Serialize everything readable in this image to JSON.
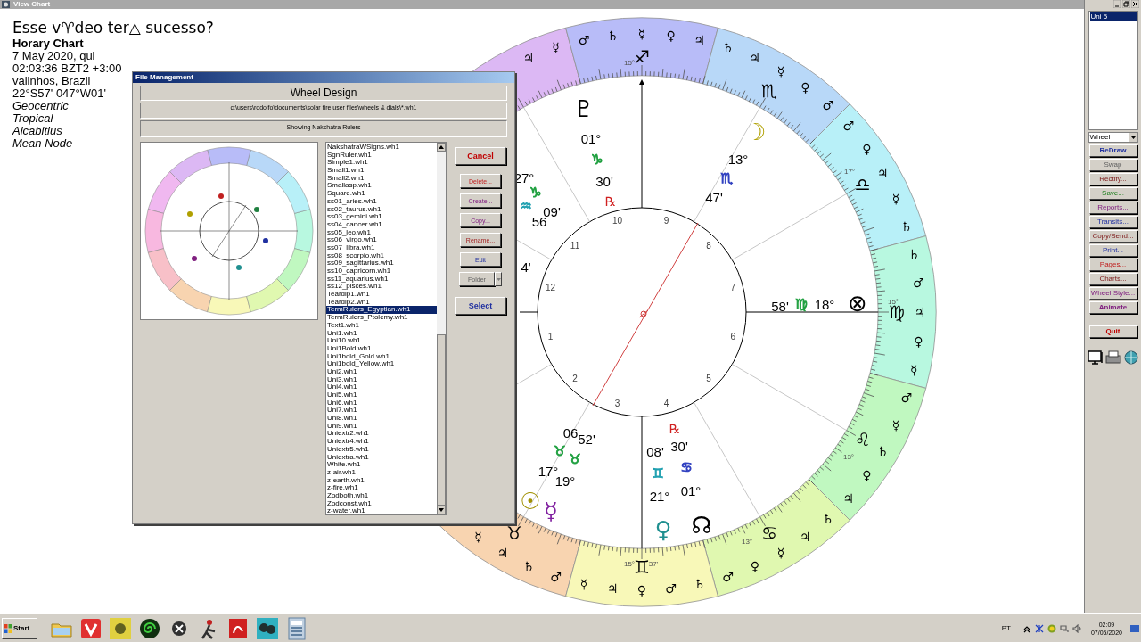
{
  "window": {
    "title": "View Chart"
  },
  "chart_info": {
    "question": "Esse v♈deo ter△ sucesso?",
    "lines": [
      {
        "text": "Horary Chart",
        "kind": "heading"
      },
      {
        "text": "7 May 2020, qui",
        "kind": "detail"
      },
      {
        "text": "02:03:36  BZT2 +3:00",
        "kind": "detail"
      },
      {
        "text": "valinhos, Brazil",
        "kind": "detail"
      },
      {
        "text": "22°S57' 047°W01'",
        "kind": "detail"
      },
      {
        "text": "Geocentric",
        "kind": "setting"
      },
      {
        "text": "Tropical",
        "kind": "setting"
      },
      {
        "text": "Alcabitius",
        "kind": "setting"
      },
      {
        "text": "Mean Node",
        "kind": "setting"
      }
    ]
  },
  "wheel": {
    "signs": [
      {
        "kind": "capricorn",
        "color": "#dcb8f4",
        "terms": [
          "☿",
          "♃"
        ]
      },
      {
        "kind": "sagittarius",
        "glyph": "♐",
        "color": "#b8bcf8",
        "terms": [
          "♂",
          "♄",
          "☿",
          "♀",
          "♃"
        ]
      },
      {
        "kind": "scorpio",
        "glyph": "♏",
        "color": "#b8d8f8",
        "terms": [
          "♄",
          "♃",
          "☿",
          "♀",
          "♂"
        ]
      },
      {
        "kind": "libra",
        "glyph": "♎",
        "color": "#b8f0f8",
        "terms": [
          "♂",
          "♀",
          "♃",
          "☿",
          "♄"
        ]
      },
      {
        "kind": "virgo",
        "glyph": "♍",
        "color": "#b8f8e0",
        "terms": [
          "♄",
          "♂",
          "♃",
          "♀",
          "☿"
        ]
      },
      {
        "kind": "leo",
        "glyph": "♌",
        "color": "#c0f8c0",
        "terms": [
          "♂",
          "☿",
          "♄",
          "♀",
          "♃"
        ]
      },
      {
        "kind": "taurus",
        "glyph": "♉",
        "color": "#f8d4b0",
        "terms": [
          "☿",
          "♃",
          "♄",
          "♂"
        ]
      },
      {
        "kind": "cancer",
        "glyph": "♋",
        "color": "#e0f8b0",
        "terms": [
          "♄",
          "♃",
          "☿",
          "♀",
          "♂"
        ]
      },
      {
        "kind": "gemini",
        "glyph": "♊",
        "color": "#f8f8b8",
        "terms": [
          "☿",
          "♃",
          "♀",
          "♂",
          "♄"
        ]
      }
    ],
    "ring_labels": [
      "15°",
      "17°",
      "15°",
      "13°",
      "13°",
      "15°",
      "37'"
    ],
    "house_numbers": [
      "1",
      "2",
      "3",
      "4",
      "5",
      "6",
      "7",
      "8",
      "9",
      "10",
      "11",
      "12"
    ],
    "marks": [
      {
        "kind": "planet",
        "text": "♇",
        "color": "#000000"
      },
      {
        "kind": "label",
        "text": "01°"
      },
      {
        "kind": "sign",
        "text": "♑",
        "color": "#20a040"
      },
      {
        "kind": "label",
        "text": "30'"
      },
      {
        "kind": "retrograde",
        "text": "℞"
      },
      {
        "kind": "planet",
        "text": "☽",
        "color": "#b0a000"
      },
      {
        "kind": "label",
        "text": "13°"
      },
      {
        "kind": "sign",
        "text": "♏",
        "color": "#3040c0"
      },
      {
        "kind": "label",
        "text": "47'"
      },
      {
        "kind": "label",
        "text": "27°"
      },
      {
        "kind": "sign",
        "text": "♑",
        "color": "#20a040"
      },
      {
        "kind": "sign",
        "text": "♒",
        "color": "#20a0b0"
      },
      {
        "kind": "label",
        "text": "09'"
      },
      {
        "kind": "label",
        "text": "56"
      },
      {
        "kind": "label",
        "text": "4'"
      },
      {
        "kind": "label",
        "text": "58'"
      },
      {
        "kind": "sign",
        "text": "♍",
        "color": "#20a040"
      },
      {
        "kind": "label",
        "text": "18°"
      },
      {
        "kind": "planet",
        "text": "⊗",
        "color": "#000000"
      },
      {
        "kind": "label",
        "text": "06"
      },
      {
        "kind": "label",
        "text": "52'"
      },
      {
        "kind": "sign",
        "text": "♉",
        "color": "#20a040"
      },
      {
        "kind": "sign",
        "text": "♉",
        "color": "#20a040"
      },
      {
        "kind": "label",
        "text": "17°"
      },
      {
        "kind": "label",
        "text": "19°"
      },
      {
        "kind": "planet",
        "text": "☉",
        "color": "#a09000"
      },
      {
        "kind": "planet",
        "text": "☿",
        "color": "#8020a0"
      },
      {
        "kind": "retrograde",
        "text": "℞"
      },
      {
        "kind": "label",
        "text": "08'"
      },
      {
        "kind": "label",
        "text": "30'"
      },
      {
        "kind": "sign",
        "text": "♊",
        "color": "#20a0b0"
      },
      {
        "kind": "sign",
        "text": "♋",
        "color": "#3040c0"
      },
      {
        "kind": "label",
        "text": "21°"
      },
      {
        "kind": "label",
        "text": "01°"
      },
      {
        "kind": "planet",
        "text": "♀",
        "color": "#209090"
      },
      {
        "kind": "planet",
        "text": "☊",
        "color": "#000000"
      }
    ]
  },
  "dialog": {
    "title": "File Management",
    "heading": "Wheel Design",
    "path": "c:\\users\\rodolfo\\documents\\solar fire user files\\wheels & dials\\*.wh1",
    "status": "Showing Nakshatra Rulers",
    "files": [
      {
        "name": "NakshatraWSigns.wh1",
        "selected": false
      },
      {
        "name": "SgnRuler.wh1",
        "selected": false
      },
      {
        "name": "Simple1.wh1",
        "selected": false
      },
      {
        "name": "Small1.wh1",
        "selected": false
      },
      {
        "name": "Small2.wh1",
        "selected": false
      },
      {
        "name": "Smallasp.wh1",
        "selected": false
      },
      {
        "name": "Square.wh1",
        "selected": false
      },
      {
        "name": "ss01_aries.wh1",
        "selected": false
      },
      {
        "name": "ss02_taurus.wh1",
        "selected": false
      },
      {
        "name": "ss03_gemini.wh1",
        "selected": false
      },
      {
        "name": "ss04_cancer.wh1",
        "selected": false
      },
      {
        "name": "ss05_leo.wh1",
        "selected": false
      },
      {
        "name": "ss06_virgo.wh1",
        "selected": false
      },
      {
        "name": "ss07_libra.wh1",
        "selected": false
      },
      {
        "name": "ss08_scorpio.wh1",
        "selected": false
      },
      {
        "name": "ss09_sagittarius.wh1",
        "selected": false
      },
      {
        "name": "ss10_capricorn.wh1",
        "selected": false
      },
      {
        "name": "ss11_aquarius.wh1",
        "selected": false
      },
      {
        "name": "ss12_pisces.wh1",
        "selected": false
      },
      {
        "name": "Teardip1.wh1",
        "selected": false
      },
      {
        "name": "Teardip2.wh1",
        "selected": false
      },
      {
        "name": "TermRulers_Egyptian.wh1",
        "selected": true
      },
      {
        "name": "TermRulers_Ptolemy.wh1",
        "selected": false
      },
      {
        "name": "Text1.wh1",
        "selected": false
      },
      {
        "name": "Uni1.wh1",
        "selected": false
      },
      {
        "name": "Uni10.wh1",
        "selected": false
      },
      {
        "name": "Uni1Bold.wh1",
        "selected": false
      },
      {
        "name": "Uni1bold_Gold.wh1",
        "selected": false
      },
      {
        "name": "Uni1bold_Yellow.wh1",
        "selected": false
      },
      {
        "name": "Uni2.wh1",
        "selected": false
      },
      {
        "name": "Uni3.wh1",
        "selected": false
      },
      {
        "name": "Uni4.wh1",
        "selected": false
      },
      {
        "name": "Uni5.wh1",
        "selected": false
      },
      {
        "name": "Uni6.wh1",
        "selected": false
      },
      {
        "name": "Uni7.wh1",
        "selected": false
      },
      {
        "name": "Uni8.wh1",
        "selected": false
      },
      {
        "name": "Uni9.wh1",
        "selected": false
      },
      {
        "name": "Uniextr2.wh1",
        "selected": false
      },
      {
        "name": "Uniextr4.wh1",
        "selected": false
      },
      {
        "name": "Uniextr5.wh1",
        "selected": false
      },
      {
        "name": "Uniextra.wh1",
        "selected": false
      },
      {
        "name": "White.wh1",
        "selected": false
      },
      {
        "name": "z-air.wh1",
        "selected": false
      },
      {
        "name": "z-earth.wh1",
        "selected": false
      },
      {
        "name": "z-fire.wh1",
        "selected": false
      },
      {
        "name": "Zodboth.wh1",
        "selected": false
      },
      {
        "name": "Zodconst.wh1",
        "selected": false
      },
      {
        "name": "z-water.wh1",
        "selected": false
      }
    ],
    "buttons": [
      {
        "label": "Cancel",
        "kind": "large",
        "disabled": false
      },
      {
        "label": "Delete...",
        "kind": "small",
        "disabled": false
      },
      {
        "label": "Create...",
        "kind": "small",
        "disabled": false
      },
      {
        "label": "Copy...",
        "kind": "small",
        "disabled": false
      },
      {
        "label": "Rename...",
        "kind": "small",
        "disabled": false
      },
      {
        "label": "Edit",
        "kind": "small",
        "disabled": false
      },
      {
        "label": "Folder",
        "kind": "split",
        "disabled": true
      },
      {
        "label": "Select",
        "kind": "large",
        "disabled": false
      }
    ]
  },
  "side_panel": {
    "charts": [
      {
        "name": "Uni 5",
        "selected": true
      }
    ],
    "view": "Wheel",
    "buttons": [
      {
        "label": "ReDraw",
        "disabled": false
      },
      {
        "label": "Swap",
        "disabled": true
      },
      {
        "label": "Rectify...",
        "disabled": false
      },
      {
        "label": "Save...",
        "disabled": false
      },
      {
        "label": "Reports...",
        "disabled": false
      },
      {
        "label": "Transits...",
        "disabled": false
      },
      {
        "label": "Copy/Send...",
        "disabled": false
      },
      {
        "label": "Print...",
        "disabled": false
      },
      {
        "label": "Pages...",
        "disabled": false
      },
      {
        "label": "Charts...",
        "disabled": false
      },
      {
        "label": "Wheel Style...",
        "disabled": false
      },
      {
        "label": "Animate",
        "disabled": false
      },
      {
        "label": "Quit",
        "disabled": false
      }
    ]
  },
  "taskbar": {
    "start": "Start",
    "language": "PT",
    "time": "02:09",
    "date": "07/05/2020"
  }
}
